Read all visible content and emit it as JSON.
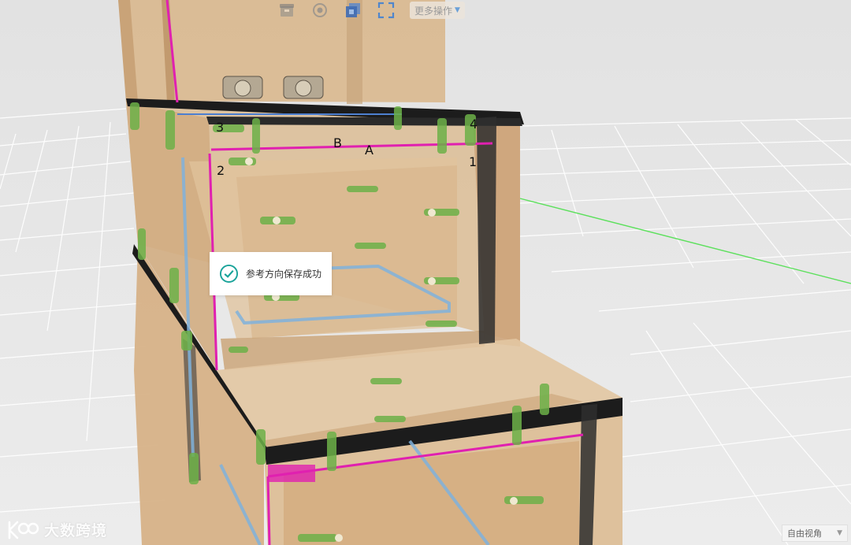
{
  "toolbar": {
    "buttons": [
      {
        "icon": "box-icon"
      },
      {
        "icon": "target-icon"
      },
      {
        "icon": "layers-icon"
      },
      {
        "icon": "fullscreen-icon"
      }
    ],
    "more_label": "更多操作"
  },
  "toast": {
    "message": "参考方向保存成功",
    "color": "#1aa39a"
  },
  "points": {
    "p1": "1",
    "p2": "2",
    "p3": "3",
    "p4": "4",
    "a": "A",
    "b": "B"
  },
  "logo": {
    "text": "大数跨境"
  },
  "view_select": {
    "value": "自由视角"
  },
  "colors": {
    "background": "#e9e9e9",
    "wood": "#d8b88f",
    "edge_black": "#1c1c1c",
    "pink": "#e020b0",
    "blue": "#7fb2dc",
    "green_connector": "#6cb048",
    "axis_green": "#5ce05c"
  }
}
